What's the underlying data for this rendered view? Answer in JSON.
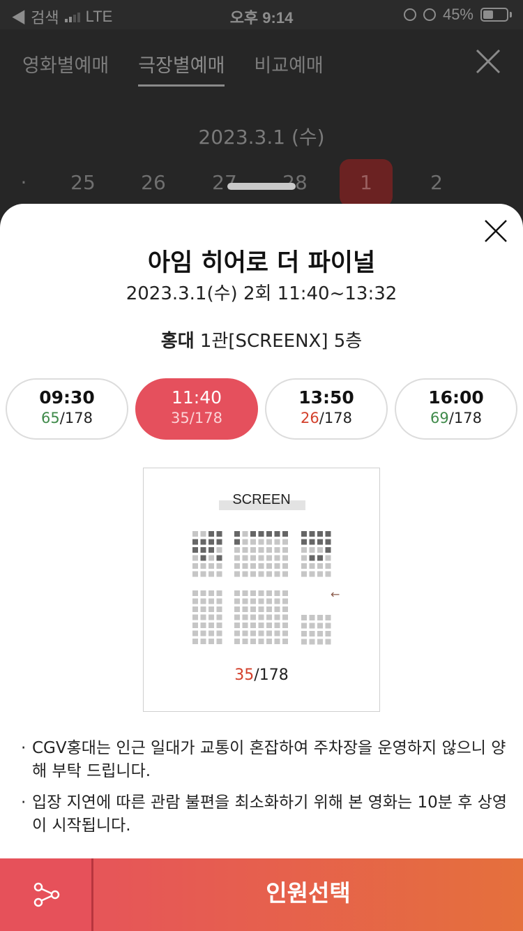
{
  "status_bar": {
    "back_label": "◀ 검색",
    "carrier": "LTE",
    "time": "오후 9:14",
    "battery": "45%"
  },
  "nav": {
    "tabs": [
      {
        "label": "영화별예매",
        "active": false
      },
      {
        "label": "극장별예매",
        "active": true
      },
      {
        "label": "비교예매",
        "active": false
      }
    ]
  },
  "date_picker": {
    "current_date": "2023.3.1 (수)",
    "days": [
      {
        "label": "·",
        "selected": false
      },
      {
        "label": "25",
        "selected": false
      },
      {
        "label": "26",
        "selected": false
      },
      {
        "label": "27",
        "selected": false
      },
      {
        "label": "28",
        "selected": false
      },
      {
        "label": "1",
        "selected": true
      },
      {
        "label": "2",
        "selected": false
      }
    ]
  },
  "sheet": {
    "movie_title": "아임 히어로 더 파이널",
    "show_info": "2023.3.1(수) 2회 11:40~13:32",
    "theater_name": "홍대",
    "theater_detail": "1관[SCREENX] 5층",
    "showtimes": [
      {
        "time": "09:30",
        "available": "65",
        "total": "/178",
        "status_color": "#3f8a4a",
        "selected": false
      },
      {
        "time": "11:40",
        "available": "35",
        "total": "/178",
        "status_color": "#fbd3d6",
        "selected": true
      },
      {
        "time": "13:50",
        "available": "26",
        "total": "/178",
        "status_color": "#d3402b",
        "selected": false
      },
      {
        "time": "16:00",
        "available": "69",
        "total": "/178",
        "status_color": "#3f8a4a",
        "selected": false
      }
    ],
    "seatmap": {
      "screen_label": "SCREEN",
      "available": "35",
      "total": "/178",
      "exit_arrow": "←"
    },
    "notes": [
      "CGV홍대는 인근 일대가 교통이 혼잡하여 주차장을 운영하지 않으니 양해 부탁 드립니다.",
      "입장 지연에 따른 관람 불편을 최소화하기 위해 본 영화는 10분 후 상영이 시작됩니다."
    ]
  },
  "bottom_bar": {
    "share_icon": "share-icon",
    "book_label": "인원선택"
  },
  "colors": {
    "accent": "#e5505d",
    "available_green": "#3f8a4a",
    "available_red": "#d3402b"
  }
}
